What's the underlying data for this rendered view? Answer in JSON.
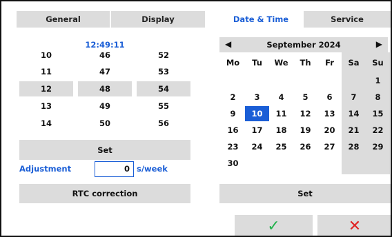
{
  "tabs": [
    "General",
    "Display",
    "Date & Time",
    "Service"
  ],
  "time": {
    "readout": "12:49:11",
    "hours": [
      "10",
      "11",
      "12",
      "13",
      "14"
    ],
    "minutes": [
      "46",
      "47",
      "48",
      "49",
      "50"
    ],
    "seconds": [
      "52",
      "53",
      "54",
      "55",
      "56"
    ]
  },
  "time_set_label": "Set",
  "adjustment": {
    "label": "Adjustment",
    "value": "0",
    "unit": "s/week"
  },
  "rtc_label": "RTC correction",
  "calendar": {
    "month_title": "September 2024",
    "prev_icon": "◀",
    "next_icon": "▶",
    "weekdays": [
      "Mo",
      "Tu",
      "We",
      "Th",
      "Fr",
      "Sa",
      "Su"
    ],
    "weeks": [
      [
        "",
        "",
        "",
        "",
        "",
        "",
        "1"
      ],
      [
        "2",
        "3",
        "4",
        "5",
        "6",
        "7",
        "8"
      ],
      [
        "9",
        "10",
        "11",
        "12",
        "13",
        "14",
        "15"
      ],
      [
        "16",
        "17",
        "18",
        "19",
        "20",
        "21",
        "22"
      ],
      [
        "23",
        "24",
        "25",
        "26",
        "27",
        "28",
        "29"
      ],
      [
        "30",
        "",
        "",
        "",
        "",
        "",
        ""
      ]
    ],
    "selected_day": "10"
  },
  "date_set_label": "Set",
  "confirm": {
    "ok_icon": "✓",
    "ok_color": "#22b24c",
    "cancel_icon": "✕",
    "cancel_color": "#e02424"
  },
  "colors": {
    "accent": "#1a5ed6",
    "panel": "#dcdcdc"
  }
}
